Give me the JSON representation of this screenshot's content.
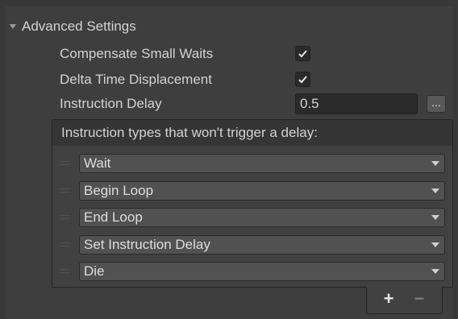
{
  "foldout": {
    "title": "Advanced Settings",
    "expanded": true
  },
  "properties": {
    "compensate_small_waits": {
      "label": "Compensate Small Waits",
      "checked": true
    },
    "delta_time_displacement": {
      "label": "Delta Time Displacement",
      "checked": true
    },
    "instruction_delay": {
      "label": "Instruction Delay",
      "value": "0.5",
      "button_label": "..."
    }
  },
  "list": {
    "header": "Instruction types that won't trigger a delay:",
    "items": [
      {
        "value": "Wait"
      },
      {
        "value": "Begin Loop"
      },
      {
        "value": "End Loop"
      },
      {
        "value": "Set Instruction Delay"
      },
      {
        "value": "Die"
      }
    ],
    "add_label": "+",
    "remove_label": "−"
  },
  "colors": {
    "background": "#383838",
    "panel": "#3e3e3e",
    "field": "#2a2a2a",
    "dropdown": "#515151",
    "text": "#d2d2d2"
  },
  "icons": {
    "foldout": "triangle-down-icon",
    "check": "checkmark-icon",
    "handle": "drag-handle-icon",
    "dropdown": "chevron-down-icon"
  }
}
